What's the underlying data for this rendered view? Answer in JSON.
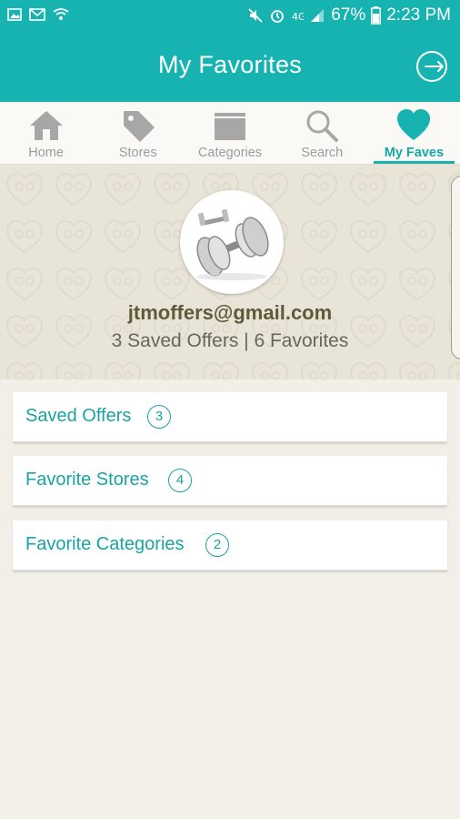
{
  "status_bar": {
    "battery": "67%",
    "time": "2:23 PM",
    "icons_left": [
      "image-icon",
      "gmail-icon",
      "wifi-icon"
    ],
    "icons_right": [
      "mute-icon",
      "alarm-icon",
      "data-icon",
      "signal-icon",
      "battery-icon"
    ]
  },
  "header": {
    "title": "My Favorites",
    "action_icon": "logout-icon"
  },
  "tabs": [
    {
      "label": "Home",
      "icon": "home-icon",
      "active": false
    },
    {
      "label": "Stores",
      "icon": "tag-icon",
      "active": false
    },
    {
      "label": "Categories",
      "icon": "folder-icon",
      "active": false
    },
    {
      "label": "Search",
      "icon": "search-icon",
      "active": false
    },
    {
      "label": "My Faves",
      "icon": "heart-icon",
      "active": true
    }
  ],
  "profile": {
    "email": "jtmoffers@gmail.com",
    "summary": "3 Saved Offers | 6 Favorites",
    "avatar": "dumbbells-image"
  },
  "lists": [
    {
      "label": "Saved Offers",
      "count": "3"
    },
    {
      "label": "Favorite Stores",
      "count": "4"
    },
    {
      "label": "Favorite Categories",
      "count": "2"
    }
  ],
  "colors": {
    "brand": "#17b3b0",
    "accent_text": "#1aa3a4",
    "hero_bg": "#e9e4d8",
    "page_bg": "#f2efe9"
  }
}
